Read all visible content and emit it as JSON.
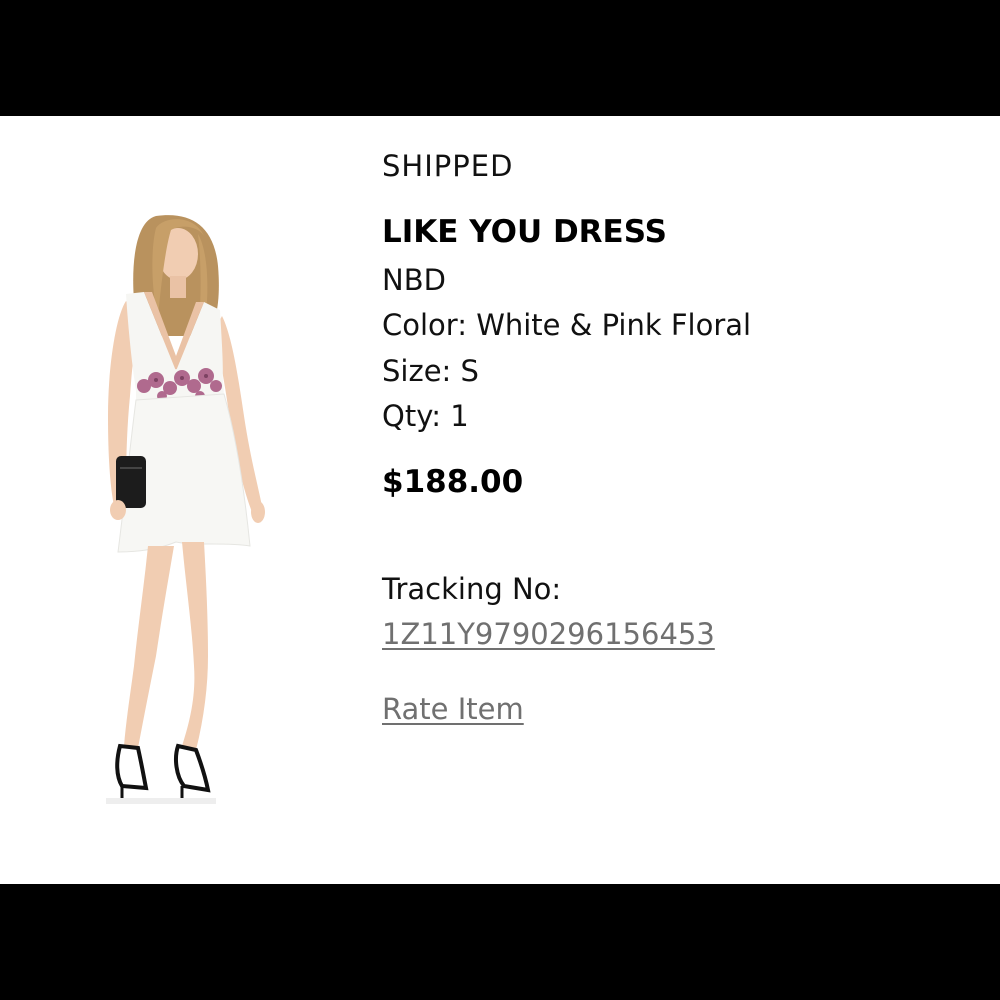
{
  "order_item": {
    "status": "SHIPPED",
    "product_name": "LIKE YOU DRESS",
    "brand": "NBD",
    "color": "Color: White & Pink Floral",
    "size": "Size: S",
    "qty": "Qty: 1",
    "price": "$188.00",
    "tracking_label": "Tracking No:",
    "tracking_number": "1Z11Y9790296156453",
    "rate_item_label": "Rate Item"
  },
  "colors": {
    "text_primary": "#111111",
    "link_gray": "#707070",
    "background": "#ffffff",
    "letterbox": "#000000"
  }
}
